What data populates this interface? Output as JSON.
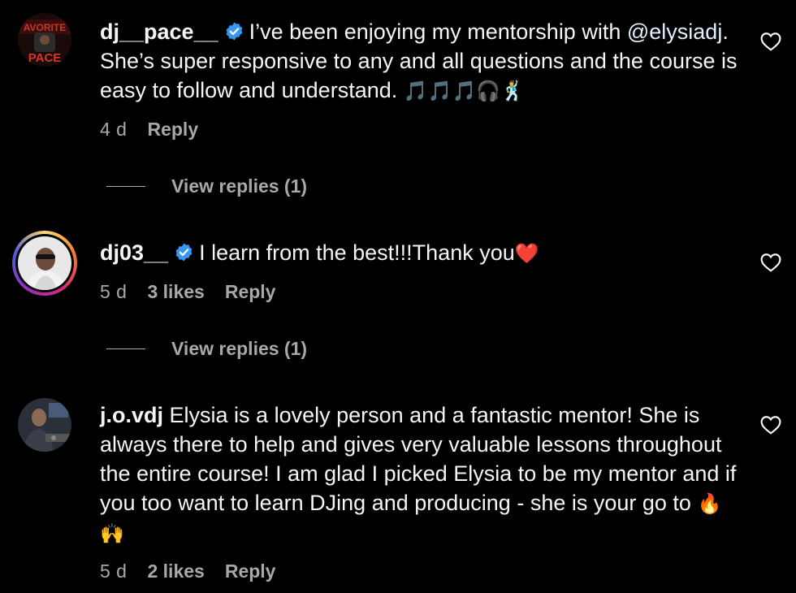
{
  "comments": [
    {
      "username": "dj__pace__",
      "verified": true,
      "text_before_mention": "I’ve been enjoying my mentorship with ",
      "mention": "@elysiadj",
      "text_after_mention": ". She’s super responsive to any and all questions and the course is easy to follow and understand. ",
      "emojis": "🎵🎵🎵🎧🕺",
      "time": "4 d",
      "likes": "",
      "reply_label": "Reply",
      "view_replies": "View replies (1)",
      "avatar_icon": "logo-avatar-icon"
    },
    {
      "username": "dj03__",
      "verified": true,
      "text": "I learn from the best!!!Thank you",
      "emojis": "❤️",
      "time": "5 d",
      "likes": "3 likes",
      "reply_label": "Reply",
      "view_replies": "View replies (1)",
      "has_story_ring": true
    },
    {
      "username": "j.o.vdj",
      "verified": false,
      "text": "Elysia is a lovely person and a fantastic mentor! She is always there to help and gives very valuable lessons throughout the entire course! I am glad I picked Elysia to be my mentor and if you too want to learn DJing and producing - she is your go to ",
      "emojis": "🔥🙌",
      "time": "5 d",
      "likes": "2 likes",
      "reply_label": "Reply"
    }
  ],
  "colors": {
    "background": "#000000",
    "text": "#f5f5f5",
    "secondary": "#a8a8a8",
    "verified": "#3897f0",
    "mention": "#e0f1ff"
  },
  "icons": {
    "verified": "verified-badge-icon",
    "like": "heart-outline-icon"
  }
}
